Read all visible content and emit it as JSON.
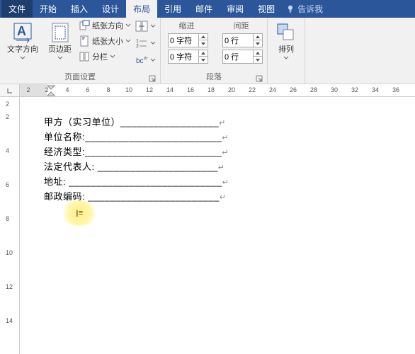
{
  "tabs": {
    "file": "文件",
    "home": "开始",
    "insert": "插入",
    "design": "设计",
    "layout": "布局",
    "references": "引用",
    "mailings": "邮件",
    "review": "审阅",
    "view": "视图",
    "tell_me": "告诉我"
  },
  "ribbon": {
    "text_direction": "文字方向",
    "margins": "页边距",
    "orientation": "纸张方向",
    "size": "纸张大小",
    "columns": "分栏",
    "page_setup_group": "页面设置",
    "indent_label": "缩进",
    "spacing_label": "间距",
    "indent_left": "0 字符",
    "indent_right": "0 字符",
    "spacing_before": "0 行",
    "spacing_after": "0 行",
    "paragraph_group": "段落",
    "arrange": "排列"
  },
  "ruler_h": [
    "2",
    "2",
    "4",
    "6",
    "8",
    "10",
    "12",
    "14",
    "16",
    "18",
    "20",
    "22",
    "24",
    "26",
    "28",
    "30",
    "32",
    "34",
    "36"
  ],
  "ruler_v": [
    "2",
    "2",
    "4",
    "6",
    "8",
    "10",
    "12",
    "14"
  ],
  "document": {
    "lines": [
      "甲方（实习单位）__________________",
      "单位名称:_________________________",
      "经济类型:_________________________",
      "法定代表人: ______________________",
      "地址: ____________________________",
      "邮政编码: ________________________"
    ]
  }
}
